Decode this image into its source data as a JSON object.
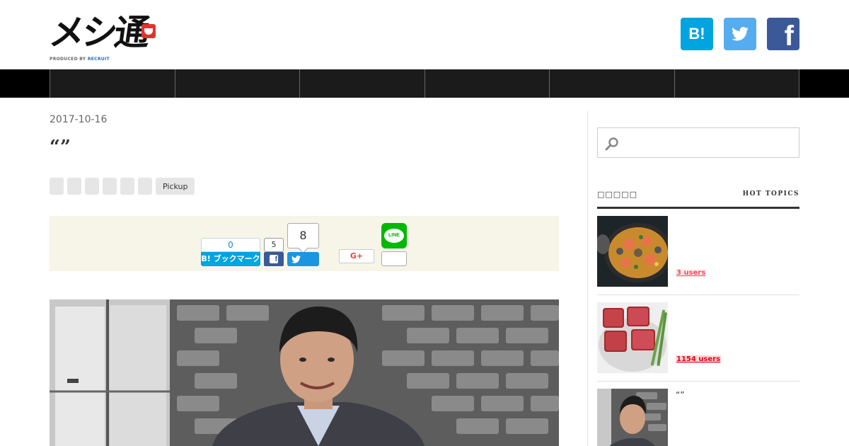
{
  "header": {
    "logo_text": "メシ通",
    "logo_sub_prefix": "PRODUCED BY ",
    "logo_sub_brand": "RECRUIT",
    "social": {
      "hatena_label": "B!",
      "facebook_label": "f"
    }
  },
  "nav": {
    "items": [
      "",
      "",
      "",
      "",
      "",
      ""
    ]
  },
  "article": {
    "date": "2017-10-16",
    "title": "“”",
    "tags": [
      "",
      "",
      "",
      "",
      "",
      "",
      "Pickup"
    ]
  },
  "share": {
    "hatena_count": "0",
    "hatena_label": "B! ブックマーク",
    "facebook_count": "5",
    "facebook_icon": "f",
    "twitter_count": "8",
    "gplus_label": "G+",
    "line_label": "LINE"
  },
  "sidebar": {
    "hot_topics_jp": "□□□□□",
    "hot_topics_en": "HOT TOPICS",
    "items": [
      {
        "title": "",
        "users": "3 users",
        "hot": false
      },
      {
        "title": "",
        "users": "1154 users",
        "hot": true
      },
      {
        "title": "“”",
        "users": "",
        "hot": false
      }
    ]
  },
  "colors": {
    "hatena": "#00a4de",
    "twitter": "#55acee",
    "facebook": "#3b5998",
    "line": "#00b900",
    "share_bg": "#f7f5e8",
    "nav_bg": "#1b1b1b"
  }
}
